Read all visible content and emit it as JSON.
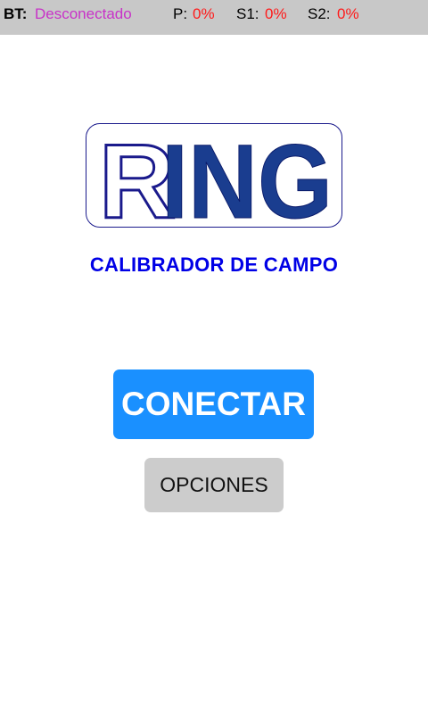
{
  "status_bar": {
    "bt_label": "BT:",
    "bt_value": "Desconectado",
    "p_label": "P:",
    "p_value": "0%",
    "s1_label": "S1:",
    "s1_value": "0%",
    "s2_label": "S2:",
    "s2_value": "0%"
  },
  "logo": {
    "text": "RING",
    "outline_letter": "R",
    "solid_letters": "ING",
    "brand_color": "#1a3d8f"
  },
  "subtitle": "CALIBRADOR DE CAMPO",
  "buttons": {
    "connect_label": "CONECTAR",
    "options_label": "OPCIONES"
  },
  "colors": {
    "status_bar_bg": "#c8c8c8",
    "disconnected": "#c832c8",
    "percent": "#ff1a1a",
    "subtitle": "#0000e6",
    "connect_bg": "#1a90ff",
    "options_bg": "#cccccc"
  }
}
